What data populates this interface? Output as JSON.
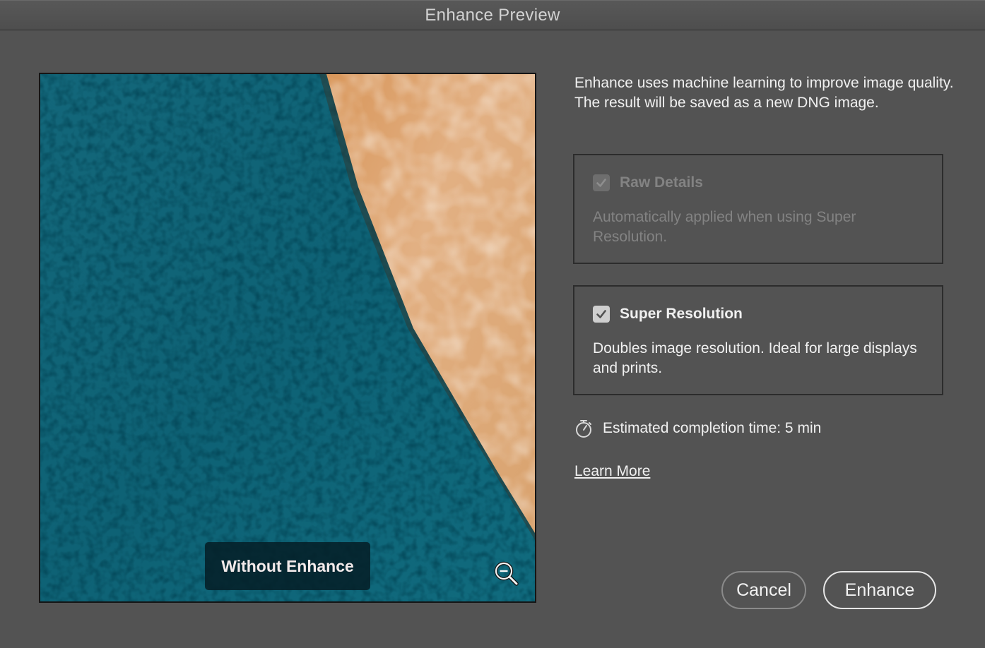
{
  "window": {
    "title": "Enhance Preview"
  },
  "preview": {
    "badge_label": "Without Enhance",
    "zoom_icon": "zoom-out-icon",
    "colors": {
      "fabric": "#0f6477",
      "skin": "#d9a775"
    }
  },
  "description": "Enhance uses machine learning to improve image quality. The result will be saved as a new DNG image.",
  "options": {
    "raw_details": {
      "label": "Raw Details",
      "description": "Automatically applied when using Super Resolution.",
      "checked": true,
      "disabled": true
    },
    "super_resolution": {
      "label": "Super Resolution",
      "description": "Doubles image resolution. Ideal for large displays and prints.",
      "checked": true,
      "disabled": false
    }
  },
  "estimate": {
    "icon": "stopwatch-icon",
    "text": "Estimated completion time: 5 min"
  },
  "learn_more": "Learn More",
  "buttons": {
    "cancel": "Cancel",
    "enhance": "Enhance"
  }
}
